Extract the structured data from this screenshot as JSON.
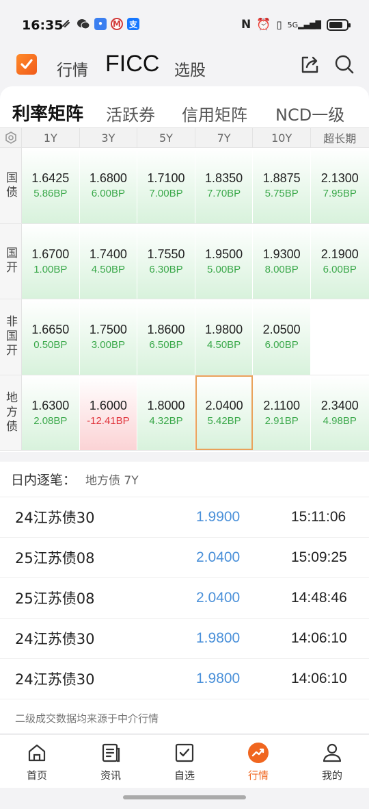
{
  "status_bar": {
    "time": "16:35",
    "network": "5G"
  },
  "header": {
    "tabs": [
      "行情",
      "FICC",
      "选股"
    ],
    "active_tab": "FICC",
    "accent_color": "#f0661f"
  },
  "sub_tabs": {
    "items": [
      "利率矩阵",
      "活跃券",
      "信用矩阵",
      "NCD一级"
    ],
    "active": "利率矩阵"
  },
  "matrix": {
    "columns": [
      "1Y",
      "3Y",
      "5Y",
      "7Y",
      "10Y",
      "超长期"
    ],
    "rows": [
      {
        "label": "国债",
        "cells": [
          {
            "yield": "1.6425",
            "bp": "5.86BP",
            "dir": "up"
          },
          {
            "yield": "1.6800",
            "bp": "6.00BP",
            "dir": "up"
          },
          {
            "yield": "1.7100",
            "bp": "7.00BP",
            "dir": "up"
          },
          {
            "yield": "1.8350",
            "bp": "7.70BP",
            "dir": "up"
          },
          {
            "yield": "1.8875",
            "bp": "5.75BP",
            "dir": "up"
          },
          {
            "yield": "2.1300",
            "bp": "7.95BP",
            "dir": "up"
          }
        ]
      },
      {
        "label": "国开",
        "cells": [
          {
            "yield": "1.6700",
            "bp": "1.00BP",
            "dir": "up"
          },
          {
            "yield": "1.7400",
            "bp": "4.50BP",
            "dir": "up"
          },
          {
            "yield": "1.7550",
            "bp": "6.30BP",
            "dir": "up"
          },
          {
            "yield": "1.9500",
            "bp": "5.00BP",
            "dir": "up"
          },
          {
            "yield": "1.9300",
            "bp": "8.00BP",
            "dir": "up"
          },
          {
            "yield": "2.1900",
            "bp": "6.00BP",
            "dir": "up"
          }
        ]
      },
      {
        "label": "非国开",
        "cells": [
          {
            "yield": "1.6650",
            "bp": "0.50BP",
            "dir": "up"
          },
          {
            "yield": "1.7500",
            "bp": "3.00BP",
            "dir": "up"
          },
          {
            "yield": "1.8600",
            "bp": "6.50BP",
            "dir": "up"
          },
          {
            "yield": "1.9800",
            "bp": "4.50BP",
            "dir": "up"
          },
          {
            "yield": "2.0500",
            "bp": "6.00BP",
            "dir": "up"
          },
          {
            "yield": "",
            "bp": "",
            "dir": "empty"
          }
        ]
      },
      {
        "label": "地方债",
        "cells": [
          {
            "yield": "1.6300",
            "bp": "2.08BP",
            "dir": "up"
          },
          {
            "yield": "1.6000",
            "bp": "-12.41BP",
            "dir": "down"
          },
          {
            "yield": "1.8000",
            "bp": "4.32BP",
            "dir": "up"
          },
          {
            "yield": "2.0400",
            "bp": "5.42BP",
            "dir": "up",
            "selected": true
          },
          {
            "yield": "2.1100",
            "bp": "2.91BP",
            "dir": "up"
          },
          {
            "yield": "2.3400",
            "bp": "4.98BP",
            "dir": "up"
          }
        ]
      }
    ]
  },
  "intraday": {
    "title": "日内逐笔：",
    "selection": "地方债 7Y",
    "trades": [
      {
        "name": "24江苏债30",
        "price": "1.9900",
        "time": "15:11:06"
      },
      {
        "name": "25江苏债08",
        "price": "2.0400",
        "time": "15:09:25"
      },
      {
        "name": "25江苏债08",
        "price": "2.0400",
        "time": "14:48:46"
      },
      {
        "name": "24江苏债30",
        "price": "1.9800",
        "time": "14:06:10"
      },
      {
        "name": "24江苏债30",
        "price": "1.9800",
        "time": "14:06:10"
      }
    ],
    "footnote": "二级成交数据均来源于中介行情"
  },
  "bottom_nav": {
    "items": [
      {
        "label": "首页",
        "icon": "home-icon"
      },
      {
        "label": "资讯",
        "icon": "news-icon"
      },
      {
        "label": "自选",
        "icon": "watchlist-icon"
      },
      {
        "label": "行情",
        "icon": "market-icon"
      },
      {
        "label": "我的",
        "icon": "profile-icon"
      }
    ],
    "active": "行情"
  }
}
